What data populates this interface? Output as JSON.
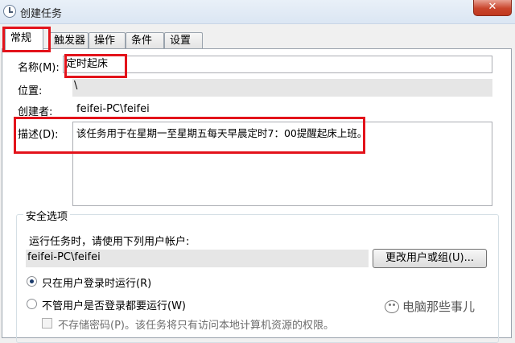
{
  "window": {
    "title": "创建任务",
    "close_label": "✕"
  },
  "tabs": [
    {
      "label": "常规"
    },
    {
      "label": "触发器"
    },
    {
      "label": "操作"
    },
    {
      "label": "条件"
    },
    {
      "label": "设置"
    }
  ],
  "general": {
    "name_label": "名称(M):",
    "name_value": "定时起床",
    "location_label": "位置:",
    "location_value": "\\",
    "author_label": "创建者:",
    "author_value": "feifei-PC\\feifei",
    "description_label": "描述(D):",
    "description_value": "该任务用于在星期一至星期五每天早晨定时7：00提醒起床上班。"
  },
  "security": {
    "group_title": "安全选项",
    "run_as_text": "运行任务时，请使用下列用户帐户:",
    "account_value": "feifei-PC\\feifei",
    "change_user_button": "更改用户或组(U)...",
    "option_logged_on": "只在用户登录时运行(R)",
    "option_logged_on_checked": true,
    "option_whether_logged": "不管用户是否登录都要运行(W)",
    "option_whether_logged_checked": false,
    "no_store_password": "不存储密码(P)。该任务将只有访问本地计算机资源的权限。",
    "no_store_password_checked": false
  },
  "watermark": {
    "text": "电脑那些事儿",
    "icon": "wechat-icon"
  },
  "highlight_color": "#e3131b"
}
